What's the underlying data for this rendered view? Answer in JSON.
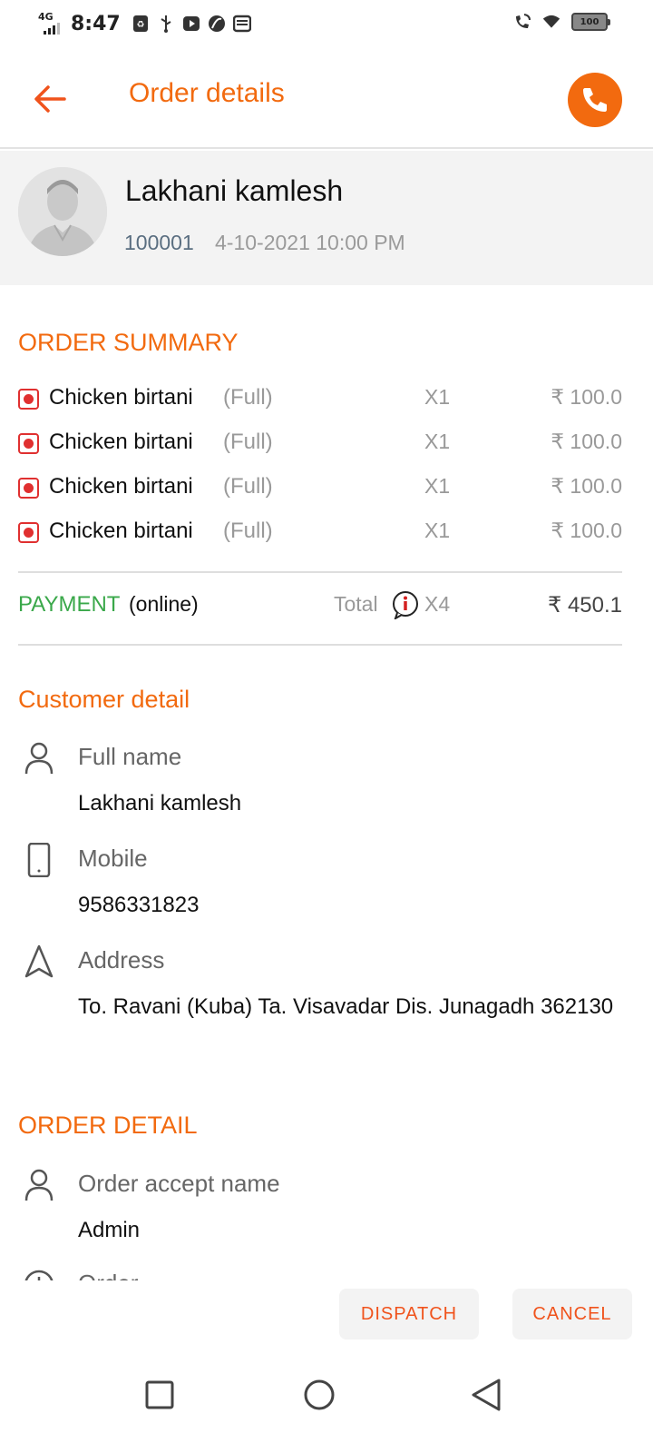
{
  "status_bar": {
    "network": "4G",
    "time": "8:47",
    "battery": "100",
    "icons": [
      "network-signal-icon",
      "usb-icon",
      "youtube-icon",
      "leaf-icon",
      "mail-icon",
      "wifi-calling-icon",
      "wifi-icon",
      "battery-icon"
    ]
  },
  "app_bar": {
    "title": "Order details",
    "back_icon": "arrow-left-icon",
    "call_icon": "phone-icon"
  },
  "customer_header": {
    "name": "Lakhani kamlesh",
    "order_id": "100001",
    "datetime": "4-10-2021 10:00 PM"
  },
  "order_summary": {
    "title": "ORDER SUMMARY",
    "items": [
      {
        "name": "Chicken birtani",
        "variant": "(Full)",
        "qty": "X1",
        "price": "₹ 100.0"
      },
      {
        "name": "Chicken birtani",
        "variant": "(Full)",
        "qty": "X1",
        "price": "₹ 100.0"
      },
      {
        "name": "Chicken birtani",
        "variant": "(Full)",
        "qty": "X1",
        "price": "₹ 100.0"
      },
      {
        "name": "Chicken birtani",
        "variant": "(Full)",
        "qty": "X1",
        "price": "₹ 100.0"
      }
    ]
  },
  "payment": {
    "label": "PAYMENT",
    "mode": "(online)",
    "total_label": "Total",
    "qty": "X4",
    "amount": "₹ 450.1"
  },
  "customer_detail": {
    "title": "Customer detail",
    "full_name_label": "Full name",
    "full_name": "Lakhani kamlesh",
    "mobile_label": "Mobile",
    "mobile": "9586331823",
    "address_label": "Address",
    "address": "To. Ravani (Kuba) Ta. Visavadar Dis. Junagadh 362130"
  },
  "order_detail": {
    "title": "ORDER DETAIL",
    "accept_name_label": "Order accept name",
    "accept_name": "Admin",
    "next_label": "Order"
  },
  "actions": {
    "dispatch": "DISPATCH",
    "cancel": "CANCEL"
  },
  "colors": {
    "accent": "#f26a0f",
    "payment_green": "#3aa84a",
    "veg_mark": "#e03030"
  }
}
